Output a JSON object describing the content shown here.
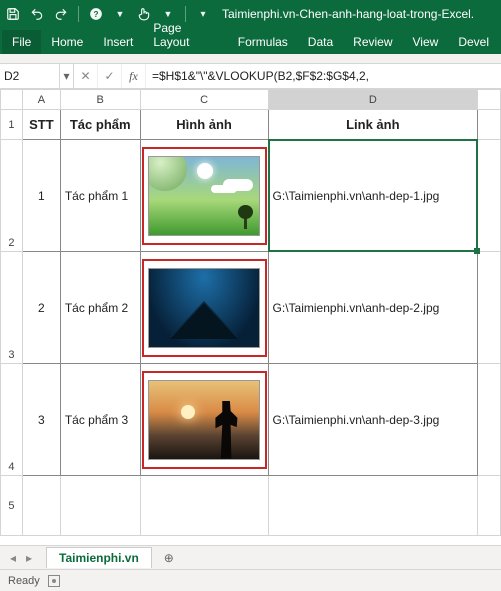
{
  "titlebar": {
    "title": "Taimienphi.vn-Chen-anh-hang-loat-trong-Excel."
  },
  "ribbon": {
    "tabs": [
      "File",
      "Home",
      "Insert",
      "Page Layout",
      "Formulas",
      "Data",
      "Review",
      "View",
      "Devel"
    ]
  },
  "formula_bar": {
    "namebox": "D2",
    "formula": "=$H$1&\"\\\"&VLOOKUP(B2,$F$2:$G$4,2,"
  },
  "columns": {
    "A": "A",
    "B": "B",
    "C": "C",
    "D": "D"
  },
  "row_heads": {
    "r1": "1",
    "r2": "2",
    "r3": "3",
    "r4": "4",
    "r5": "5"
  },
  "headers": {
    "stt": "STT",
    "tacpham": "Tác phẩm",
    "hinhanh": "Hình ảnh",
    "linkanh": "Link ảnh"
  },
  "rows": [
    {
      "stt": "1",
      "tacpham": "Tác phẩm 1",
      "link": "G:\\Taimienphi.vn\\anh-dep-1.jpg"
    },
    {
      "stt": "2",
      "tacpham": "Tác phẩm 2",
      "link": "G:\\Taimienphi.vn\\anh-dep-2.jpg"
    },
    {
      "stt": "3",
      "tacpham": "Tác phẩm 3",
      "link": "G:\\Taimienphi.vn\\anh-dep-3.jpg"
    }
  ],
  "sheet_tabs": {
    "active": "Taimienphi.vn"
  },
  "statusbar": {
    "ready": "Ready"
  }
}
